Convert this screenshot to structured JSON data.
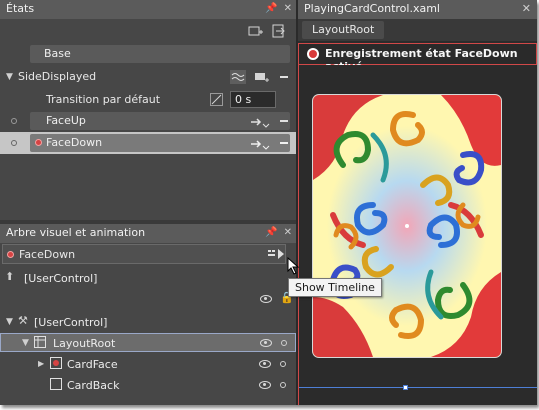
{
  "states_panel": {
    "title": "États",
    "base_state": "Base",
    "group_name": "SideDisplayed",
    "transition_label": "Transition par défaut",
    "transition_value": "0 s",
    "states": [
      "FaceUp",
      "FaceDown"
    ]
  },
  "tree_panel": {
    "title": "Arbre visuel et animation",
    "timeline_name": "FaceDown",
    "items": {
      "usercontrol_top": "[UserControl]",
      "usercontrol_root": "[UserControl]",
      "layoutroot": "LayoutRoot",
      "cardface": "CardFace",
      "cardback": "CardBack"
    }
  },
  "document": {
    "tab_title": "PlayingCardControl.xaml",
    "breadcrumb": "LayoutRoot",
    "recording_text": "Enregistrement état FaceDown activé"
  },
  "tooltip": "Show Timeline",
  "colors": {
    "recording_red": "#d83a3a",
    "selection_blue": "#4e7fd6",
    "panel_bg": "#474747"
  },
  "icons": [
    "pin-icon",
    "close-icon",
    "add-state-icon",
    "add-group-icon",
    "transition-icon",
    "remove-icon",
    "easing-icon",
    "record-icon",
    "eye-icon",
    "lock-icon",
    "show-timeline-icon",
    "expand-arrow-icon"
  ]
}
